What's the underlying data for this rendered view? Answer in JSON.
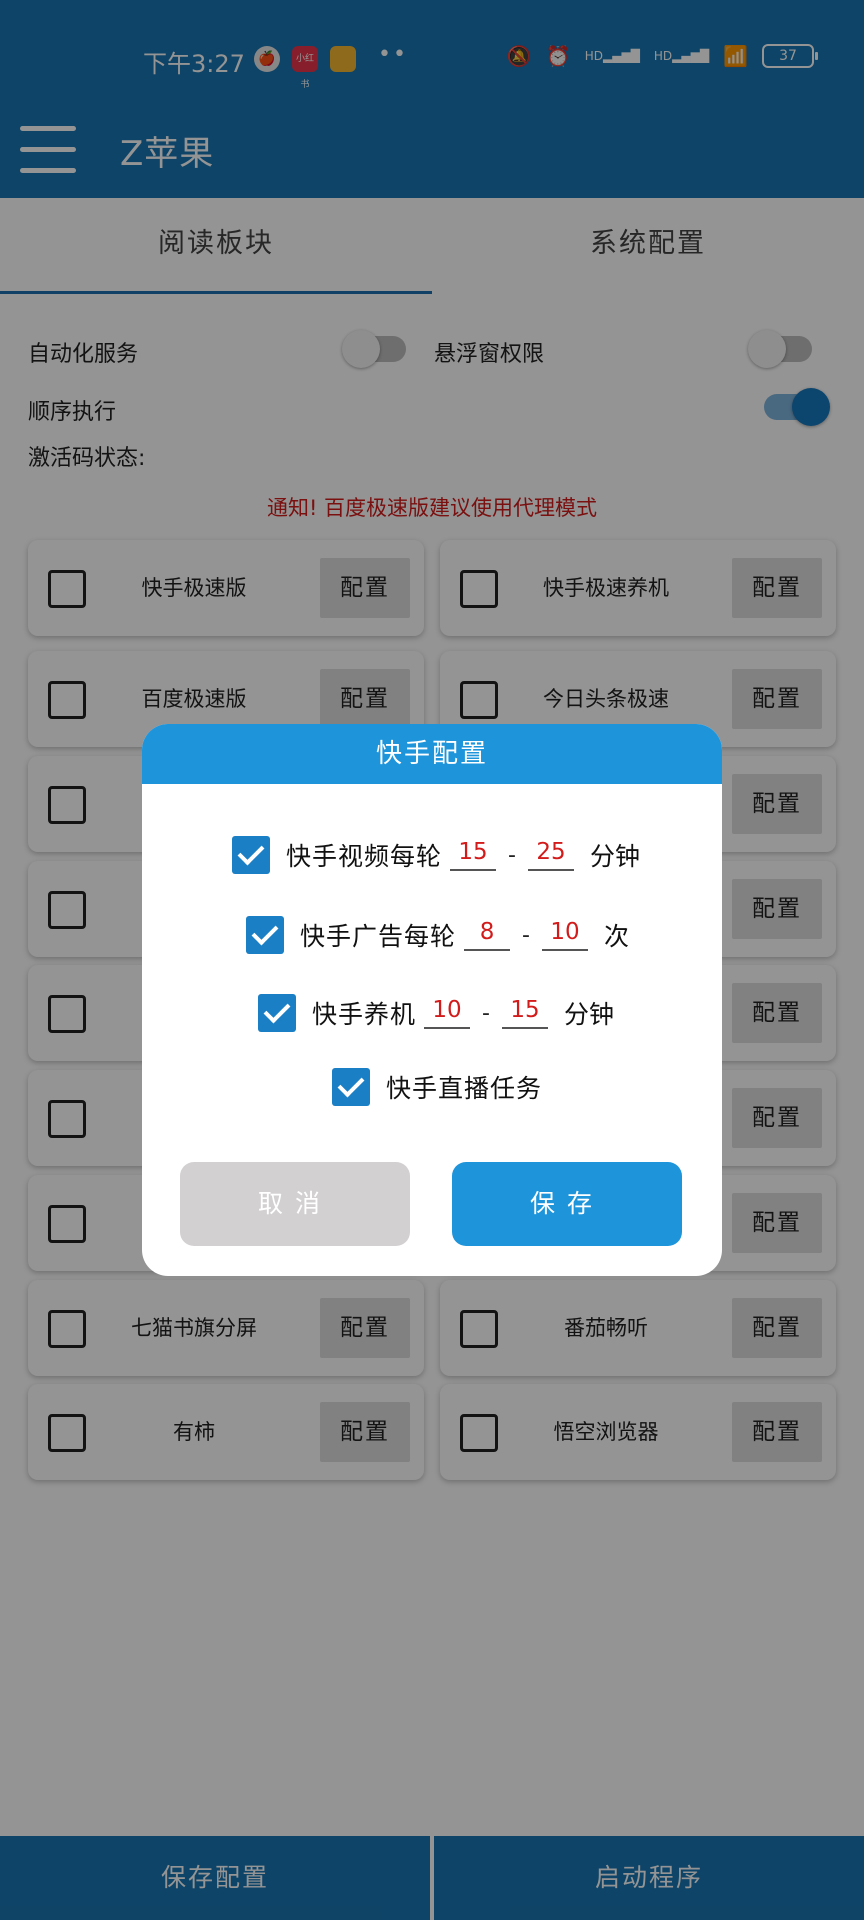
{
  "status_bar": {
    "time": "下午3:27",
    "notif_badge": "小红书",
    "battery": "37",
    "signal_1": "HD",
    "signal_2": "HD"
  },
  "app_bar": {
    "title": "Z苹果"
  },
  "tabs": [
    {
      "label": "阅读板块",
      "active": true
    },
    {
      "label": "系统配置",
      "active": false
    }
  ],
  "settings": {
    "automation_label": "自动化服务",
    "automation_on": false,
    "float_label": "悬浮窗权限",
    "float_on": false,
    "sequential_label": "顺序执行",
    "sequential_on": true,
    "activation_label": "激活码状态:"
  },
  "notice": "通知! 百度极速版建议使用代理模式",
  "cards": [
    {
      "name": "快手极速版",
      "config_label": "配置"
    },
    {
      "name": "快手极速养机",
      "config_label": "配置"
    },
    {
      "name": "百度极速版",
      "config_label": "配置"
    },
    {
      "name": "今日头条极速",
      "config_label": "配置"
    },
    {
      "name": "",
      "config_label": "配置"
    },
    {
      "name": "",
      "config_label": "配置"
    },
    {
      "name": "",
      "config_label": "配置"
    },
    {
      "name": "",
      "config_label": "配置"
    },
    {
      "name": "",
      "config_label": "配置"
    },
    {
      "name": "",
      "config_label": "配置"
    },
    {
      "name": "",
      "config_label": "配置"
    },
    {
      "name": "",
      "config_label": "配置"
    },
    {
      "name": "",
      "config_label": "配置"
    },
    {
      "name": "",
      "config_label": "配置"
    },
    {
      "name": "七猫书旗分屏",
      "config_label": "配置"
    },
    {
      "name": "番茄畅听",
      "config_label": "配置"
    },
    {
      "name": "有柿",
      "config_label": "配置"
    },
    {
      "name": "悟空浏览器",
      "config_label": "配置"
    }
  ],
  "dialog": {
    "title": "快手配置",
    "options": [
      {
        "label": "快手视频每轮",
        "min": "15",
        "max": "25",
        "unit": "分钟",
        "checked": true
      },
      {
        "label": "快手广告每轮",
        "min": "8",
        "max": "10",
        "unit": "次",
        "checked": true
      },
      {
        "label": "快手养机",
        "min": "10",
        "max": "15",
        "unit": "分钟",
        "checked": true
      },
      {
        "label": "快手直播任务",
        "checked": true
      }
    ],
    "range_separator": "-",
    "cancel_label": "取消",
    "save_label": "保存"
  },
  "bottom": {
    "save_config_label": "保存配置",
    "start_label": "启动程序"
  },
  "colors": {
    "primary": "#1976b1",
    "dialog_accent": "#1e95db",
    "notice": "#d21c1c"
  }
}
